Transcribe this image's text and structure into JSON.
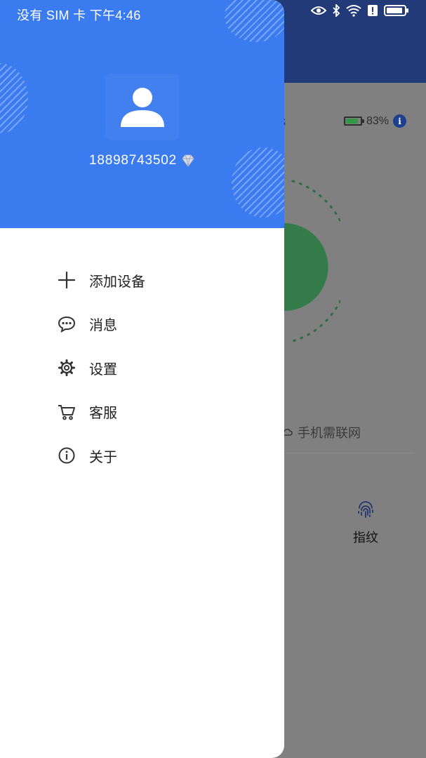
{
  "status_bar": {
    "carrier_time": "没有 SIM 卡 下午4:46",
    "icons": [
      "eye-icon",
      "bluetooth-icon",
      "wifi-icon",
      "alert-icon",
      "battery-icon"
    ]
  },
  "drawer": {
    "header_color": "#3b7bf0",
    "phone_number": "18898743502",
    "menu": [
      {
        "id": "add-device",
        "icon": "plus-icon",
        "label": "添加设备"
      },
      {
        "id": "messages",
        "icon": "chat-bubble-icon",
        "label": "消息"
      },
      {
        "id": "settings",
        "icon": "gear-icon",
        "label": "设置"
      },
      {
        "id": "customer-service",
        "icon": "cart-icon",
        "label": "客服"
      },
      {
        "id": "about",
        "icon": "info-icon",
        "label": "关于"
      }
    ]
  },
  "background_screen": {
    "header_color": "#223a78",
    "battery_text": "83%",
    "battery_fill_fraction": 0.83,
    "network_hint": "手机需联网",
    "fingerprint_label": "指纹",
    "accent_green": "#2f9a45"
  }
}
